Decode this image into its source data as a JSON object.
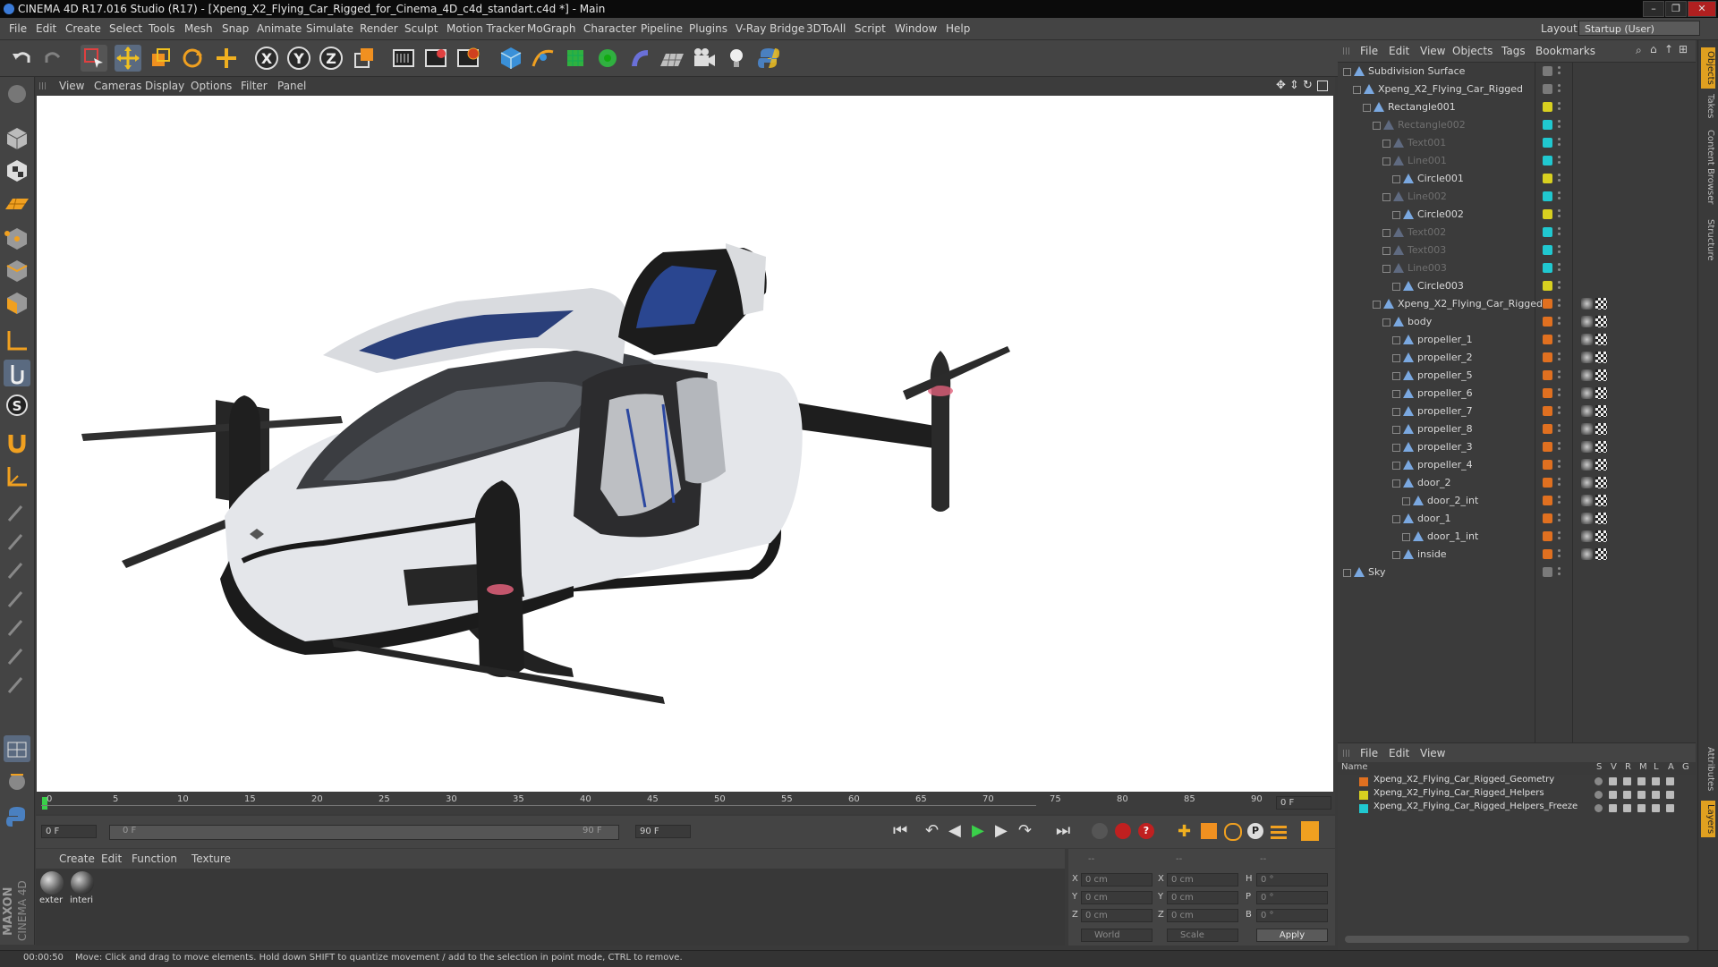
{
  "window": {
    "title": "CINEMA 4D R17.016 Studio (R17) - [Xpeng_X2_Flying_Car_Rigged_for_Cinema_4D_c4d_standart.c4d *] - Main",
    "controls": [
      "–",
      "❐",
      "✕"
    ]
  },
  "menubar": {
    "items": [
      "File",
      "Edit",
      "Create",
      "Select",
      "Tools",
      "Mesh",
      "Snap",
      "Animate",
      "Simulate",
      "Render",
      "Sculpt",
      "Motion Tracker",
      "MoGraph",
      "Character",
      "Pipeline",
      "Plugins",
      "V-Ray Bridge",
      "3DToAll",
      "Script",
      "Window",
      "Help"
    ],
    "layout_label": "Layout:",
    "layout_value": "Startup (User)"
  },
  "toolbar": {
    "axis_x": "X",
    "axis_y": "Y",
    "axis_z": "Z",
    "icons": [
      "undo-icon",
      "redo-icon",
      "select-icon",
      "move-icon",
      "scale-icon",
      "rotate-icon",
      "add-icon",
      "x-axis-icon",
      "y-axis-icon",
      "z-axis-icon",
      "coord-system-icon",
      "render-view-icon",
      "render-picture-viewer-icon",
      "render-settings-icon",
      "cube-icon",
      "pen-icon",
      "subdivision-icon",
      "cloner-icon",
      "deformer-icon",
      "floor-icon",
      "camera-icon",
      "light-icon",
      "python-icon"
    ]
  },
  "viewport": {
    "menu": [
      "View",
      "Cameras",
      "Display",
      "Options",
      "Filter",
      "Panel"
    ]
  },
  "timeline": {
    "ticks": [
      "0",
      "5",
      "10",
      "15",
      "20",
      "25",
      "30",
      "35",
      "40",
      "45",
      "50",
      "55",
      "60",
      "65",
      "70",
      "75",
      "80",
      "85",
      "90"
    ],
    "current_frame_field": "0 F",
    "start_field": "0 F",
    "range_start": "0 F",
    "range_end": "90 F",
    "end_field": "90 F"
  },
  "materials": {
    "menu": [
      "Create",
      "Edit",
      "Function",
      "Texture"
    ],
    "items": [
      {
        "label": "exter"
      },
      {
        "label": "interi"
      }
    ]
  },
  "coordinates": {
    "header_dashes": [
      "--",
      "--",
      "--"
    ],
    "rows": [
      {
        "l1": "X",
        "v1": "0 cm",
        "l2": "X",
        "v2": "0 cm",
        "l3": "H",
        "v3": "0 °"
      },
      {
        "l1": "Y",
        "v1": "0 cm",
        "l2": "Y",
        "v2": "0 cm",
        "l3": "P",
        "v3": "0 °"
      },
      {
        "l1": "Z",
        "v1": "0 cm",
        "l2": "Z",
        "v2": "0 cm",
        "l3": "B",
        "v3": "0 °"
      }
    ],
    "world": "World",
    "scale": "Scale",
    "apply": "Apply"
  },
  "object_manager": {
    "menu": [
      "File",
      "Edit",
      "View",
      "Objects",
      "Tags",
      "Bookmarks"
    ],
    "objects": [
      {
        "name": "Subdivision Surface",
        "dim": false,
        "color": "#7a7a7a"
      },
      {
        "name": "Xpeng_X2_Flying_Car_Rigged",
        "dim": false,
        "color": "#7a7a7a"
      },
      {
        "name": "Rectangle001",
        "dim": false,
        "color": "#d8d020"
      },
      {
        "name": "Rectangle002",
        "dim": true,
        "color": "#20c8d0"
      },
      {
        "name": "Text001",
        "dim": true,
        "color": "#20c8d0"
      },
      {
        "name": "Line001",
        "dim": true,
        "color": "#20c8d0"
      },
      {
        "name": "Circle001",
        "dim": false,
        "color": "#d8d020"
      },
      {
        "name": "Line002",
        "dim": true,
        "color": "#20c8d0"
      },
      {
        "name": "Circle002",
        "dim": false,
        "color": "#d8d020"
      },
      {
        "name": "Text002",
        "dim": true,
        "color": "#20c8d0"
      },
      {
        "name": "Text003",
        "dim": true,
        "color": "#20c8d0"
      },
      {
        "name": "Line003",
        "dim": true,
        "color": "#20c8d0"
      },
      {
        "name": "Circle003",
        "dim": false,
        "color": "#d8d020"
      },
      {
        "name": "Xpeng_X2_Flying_Car_Rigged",
        "dim": false,
        "color": "#e07020"
      },
      {
        "name": "body",
        "dim": false,
        "color": "#e07020"
      },
      {
        "name": "propeller_1",
        "dim": false,
        "color": "#e07020"
      },
      {
        "name": "propeller_2",
        "dim": false,
        "color": "#e07020"
      },
      {
        "name": "propeller_5",
        "dim": false,
        "color": "#e07020"
      },
      {
        "name": "propeller_6",
        "dim": false,
        "color": "#e07020"
      },
      {
        "name": "propeller_7",
        "dim": false,
        "color": "#e07020"
      },
      {
        "name": "propeller_8",
        "dim": false,
        "color": "#e07020"
      },
      {
        "name": "propeller_3",
        "dim": false,
        "color": "#e07020"
      },
      {
        "name": "propeller_4",
        "dim": false,
        "color": "#e07020"
      },
      {
        "name": "door_2",
        "dim": false,
        "color": "#e07020"
      },
      {
        "name": "door_2_int",
        "dim": false,
        "color": "#e07020"
      },
      {
        "name": "door_1",
        "dim": false,
        "color": "#e07020"
      },
      {
        "name": "door_1_int",
        "dim": false,
        "color": "#e07020"
      },
      {
        "name": "inside",
        "dim": false,
        "color": "#e07020"
      },
      {
        "name": "Sky",
        "dim": false,
        "color": "#7a7a7a"
      }
    ]
  },
  "layer_manager": {
    "menu": [
      "File",
      "Edit",
      "View"
    ],
    "headers": [
      "Name",
      "S",
      "V",
      "R",
      "M",
      "L",
      "A",
      "G"
    ],
    "layers": [
      {
        "name": "Xpeng_X2_Flying_Car_Rigged_Geometry",
        "color": "#e07020"
      },
      {
        "name": "Xpeng_X2_Flying_Car_Rigged_Helpers",
        "color": "#d8d020"
      },
      {
        "name": "Xpeng_X2_Flying_Car_Rigged_Helpers_Freeze",
        "color": "#20c8d0"
      }
    ]
  },
  "right_tabs": [
    "Objects",
    "Takes",
    "Content Browser",
    "Structure",
    "Attributes",
    "Layers"
  ],
  "status": {
    "time": "00:00:50",
    "message": "Move: Click and drag to move elements. Hold down SHIFT to quantize movement / add to the selection in point mode, CTRL to remove."
  },
  "branding": {
    "maxon": "MAXON",
    "cinema": "CINEMA 4D"
  }
}
